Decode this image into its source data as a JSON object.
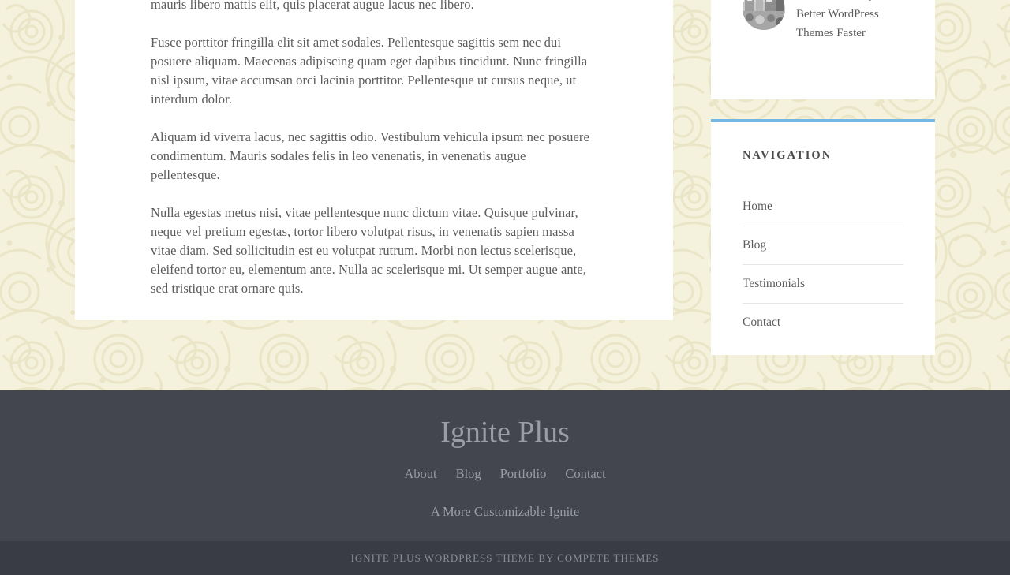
{
  "theme": {
    "background_color": "#f4f1dc",
    "pattern_color": "#eae6c8",
    "card_color": "#ffffff",
    "accent_color": "#74b9e3",
    "footer_color": "#43464f",
    "credit_bar_color": "#393c44",
    "body_text_color": "#5c5c5c",
    "footer_text_color": "#9a9da6"
  },
  "article": {
    "paragraphs": [
      "mauris libero mattis elit, quis placerat augue lacus nec libero.",
      "Fusce porttitor fringilla elit sit amet sodales. Pellentesque sagittis sem nec dui posuere aliquam. Maecenas adipiscing quam eget dapibus tincidunt. Nunc fringilla nisl ipsum, vitae accumsan orci lacinia porttitor. Pellentesque ut cursus neque, ut interdum dolor.",
      "Aliquam id viverra lacus, nec sagittis odio. Vestibulum vehicula ipsum nec posuere condimentum. Mauris sodales felis in leo venenatis, in venenatis augue pellentesque.",
      "Nulla egestas metus nisi, vitae pellentesque nunc dictum vitae. Quisque pulvinar, neque vel pretium egestas, tortor libero volutpat risus, in venenatis sapien massa vitae diam. Sed sollicitudin est eu volutpat rutrum. Morbi non lectus scelerisque, eleifend tortor eu, elementum ante. Nulla ac scelerisque mi. Ut semper augue ante, sed tristique erat ornare quis."
    ]
  },
  "sidebar": {
    "recent_posts_widget": {
      "posts": [
        {
          "title": "How to Develop Better WordPress Themes Faster",
          "thumbnail": "post-thumbnail-image"
        }
      ]
    },
    "navigation_widget": {
      "title": "Navigation",
      "items": [
        {
          "label": "Home"
        },
        {
          "label": "Blog"
        },
        {
          "label": "Testimonials"
        },
        {
          "label": "Contact"
        }
      ]
    }
  },
  "footer": {
    "title": "Ignite Plus",
    "nav": [
      {
        "label": "About"
      },
      {
        "label": "Blog"
      },
      {
        "label": "Portfolio"
      },
      {
        "label": "Contact"
      }
    ],
    "tagline": "A More Customizable Ignite",
    "credit": "Ignite Plus WordPress Theme by Compete Themes"
  }
}
